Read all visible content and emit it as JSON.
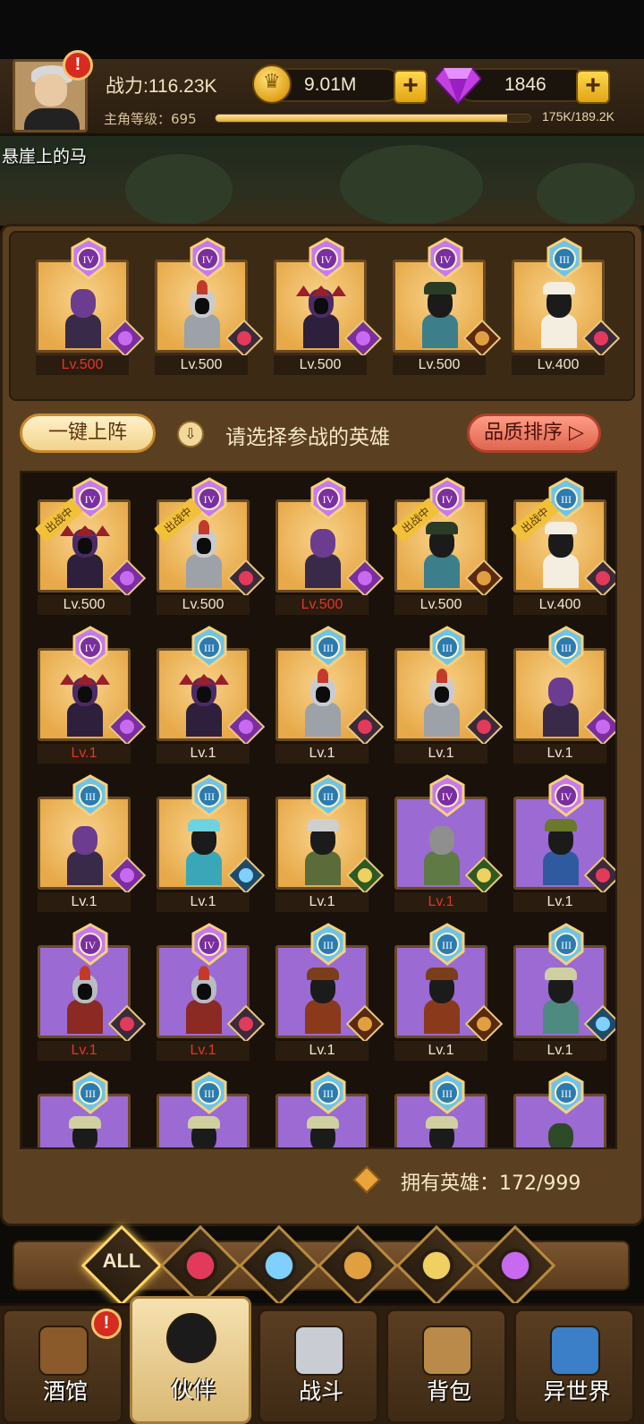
{
  "header": {
    "power": "战力:116.23K",
    "level_label": "主角等级：695",
    "xp_text": "175K/189.2K",
    "xp_progress": 0.925,
    "gold": "9.01M",
    "gems": "1846",
    "plus": "+",
    "alert": "!"
  },
  "player_name": "悬崖上的马",
  "team": [
    {
      "rank": "IV",
      "level": "Lv.500",
      "level_color": "red",
      "faction": "demon",
      "bg": "gold",
      "hero": "purple-demon"
    },
    {
      "rank": "IV",
      "level": "Lv.500",
      "level_color": "white",
      "faction": "human",
      "bg": "gold",
      "hero": "knight"
    },
    {
      "rank": "IV",
      "level": "Lv.500",
      "level_color": "white",
      "faction": "demon",
      "bg": "gold",
      "hero": "dark-lord"
    },
    {
      "rank": "IV",
      "level": "Lv.500",
      "level_color": "white",
      "faction": "beast",
      "bg": "gold",
      "hero": "pharaoh"
    },
    {
      "rank": "III",
      "level": "Lv.400",
      "level_color": "white",
      "faction": "human",
      "bg": "gold",
      "hero": "pope"
    }
  ],
  "actions": {
    "lineup_label": "一键上阵",
    "hint_text": "请选择参战的英雄",
    "sort_label": "品质排序 ▷"
  },
  "roster": [
    {
      "rank": "IV",
      "level": "Lv.500",
      "level_color": "white",
      "faction": "demon",
      "bg": "gold",
      "hero": "dark-lord",
      "deployed": true
    },
    {
      "rank": "IV",
      "level": "Lv.500",
      "level_color": "white",
      "faction": "human",
      "bg": "gold",
      "hero": "knight",
      "deployed": true
    },
    {
      "rank": "IV",
      "level": "Lv.500",
      "level_color": "red",
      "faction": "demon",
      "bg": "gold",
      "hero": "purple-demon",
      "deployed": false
    },
    {
      "rank": "IV",
      "level": "Lv.500",
      "level_color": "white",
      "faction": "beast",
      "bg": "gold",
      "hero": "pharaoh",
      "deployed": true
    },
    {
      "rank": "III",
      "level": "Lv.400",
      "level_color": "white",
      "faction": "human",
      "bg": "gold",
      "hero": "pope",
      "deployed": true
    },
    {
      "rank": "IV",
      "level": "Lv.1",
      "level_color": "red",
      "faction": "demon",
      "bg": "gold",
      "hero": "dark-lord"
    },
    {
      "rank": "III",
      "level": "Lv.1",
      "level_color": "white",
      "faction": "demon",
      "bg": "gold",
      "hero": "dark-lord"
    },
    {
      "rank": "III",
      "level": "Lv.1",
      "level_color": "white",
      "faction": "human",
      "bg": "gold",
      "hero": "knight"
    },
    {
      "rank": "III",
      "level": "Lv.1",
      "level_color": "white",
      "faction": "human",
      "bg": "gold",
      "hero": "knight"
    },
    {
      "rank": "III",
      "level": "Lv.1",
      "level_color": "white",
      "faction": "demon",
      "bg": "gold",
      "hero": "purple-demon"
    },
    {
      "rank": "III",
      "level": "Lv.1",
      "level_color": "white",
      "faction": "demon",
      "bg": "gold",
      "hero": "purple-demon"
    },
    {
      "rank": "III",
      "level": "Lv.1",
      "level_color": "white",
      "faction": "sea",
      "bg": "gold",
      "hero": "sea-mage"
    },
    {
      "rank": "III",
      "level": "Lv.1",
      "level_color": "white",
      "faction": "elf",
      "bg": "gold",
      "hero": "elf-ranger"
    },
    {
      "rank": "IV",
      "level": "Lv.1",
      "level_color": "red",
      "faction": "elf",
      "bg": "purple",
      "hero": "golem"
    },
    {
      "rank": "IV",
      "level": "Lv.1",
      "level_color": "white",
      "faction": "human",
      "bg": "purple",
      "hero": "musketeer"
    },
    {
      "rank": "IV",
      "level": "Lv.1",
      "level_color": "red",
      "faction": "human",
      "bg": "purple",
      "hero": "roman"
    },
    {
      "rank": "IV",
      "level": "Lv.1",
      "level_color": "red",
      "faction": "human",
      "bg": "purple",
      "hero": "roman"
    },
    {
      "rank": "III",
      "level": "Lv.1",
      "level_color": "white",
      "faction": "beast",
      "bg": "purple",
      "hero": "lion-man"
    },
    {
      "rank": "III",
      "level": "Lv.1",
      "level_color": "white",
      "faction": "beast",
      "bg": "purple",
      "hero": "lion-man"
    },
    {
      "rank": "III",
      "level": "Lv.1",
      "level_color": "white",
      "faction": "sea",
      "bg": "purple",
      "hero": "hooded-elder"
    },
    {
      "rank": "III",
      "level": "",
      "level_color": "white",
      "faction": "",
      "bg": "purple",
      "hero": "hooded-elder"
    },
    {
      "rank": "III",
      "level": "",
      "level_color": "white",
      "faction": "",
      "bg": "purple",
      "hero": "hooded-elder"
    },
    {
      "rank": "III",
      "level": "",
      "level_color": "white",
      "faction": "",
      "bg": "purple",
      "hero": "hooded-elder"
    },
    {
      "rank": "III",
      "level": "",
      "level_color": "white",
      "faction": "",
      "bg": "purple",
      "hero": "hooded-elder"
    },
    {
      "rank": "III",
      "level": "",
      "level_color": "white",
      "faction": "",
      "bg": "purple",
      "hero": "treant"
    }
  ],
  "deployed_label": "出战中",
  "owned_heroes": "拥有英雄：172/999",
  "filters": [
    {
      "label": "ALL",
      "icon": "all-icon"
    },
    {
      "label": "",
      "icon": "human-faction-icon"
    },
    {
      "label": "",
      "icon": "sea-faction-icon"
    },
    {
      "label": "",
      "icon": "beast-faction-icon"
    },
    {
      "label": "",
      "icon": "elf-faction-icon"
    },
    {
      "label": "",
      "icon": "demon-faction-icon"
    }
  ],
  "nav": [
    {
      "label": "酒馆",
      "icon": "tavern-beer-icon",
      "alert": "!"
    },
    {
      "label": "伙伴",
      "icon": "partner-avatar-icon"
    },
    {
      "label": "战斗",
      "icon": "battle-swords-icon"
    },
    {
      "label": "背包",
      "icon": "backpack-chest-icon"
    },
    {
      "label": "异世界",
      "icon": "otherworld-portal-icon"
    }
  ],
  "colors": {
    "gold_card": "#e7a949",
    "purple_card": "#9b6ad3",
    "level_red": "#e2342a",
    "accent_gold": "#ffd84d"
  }
}
